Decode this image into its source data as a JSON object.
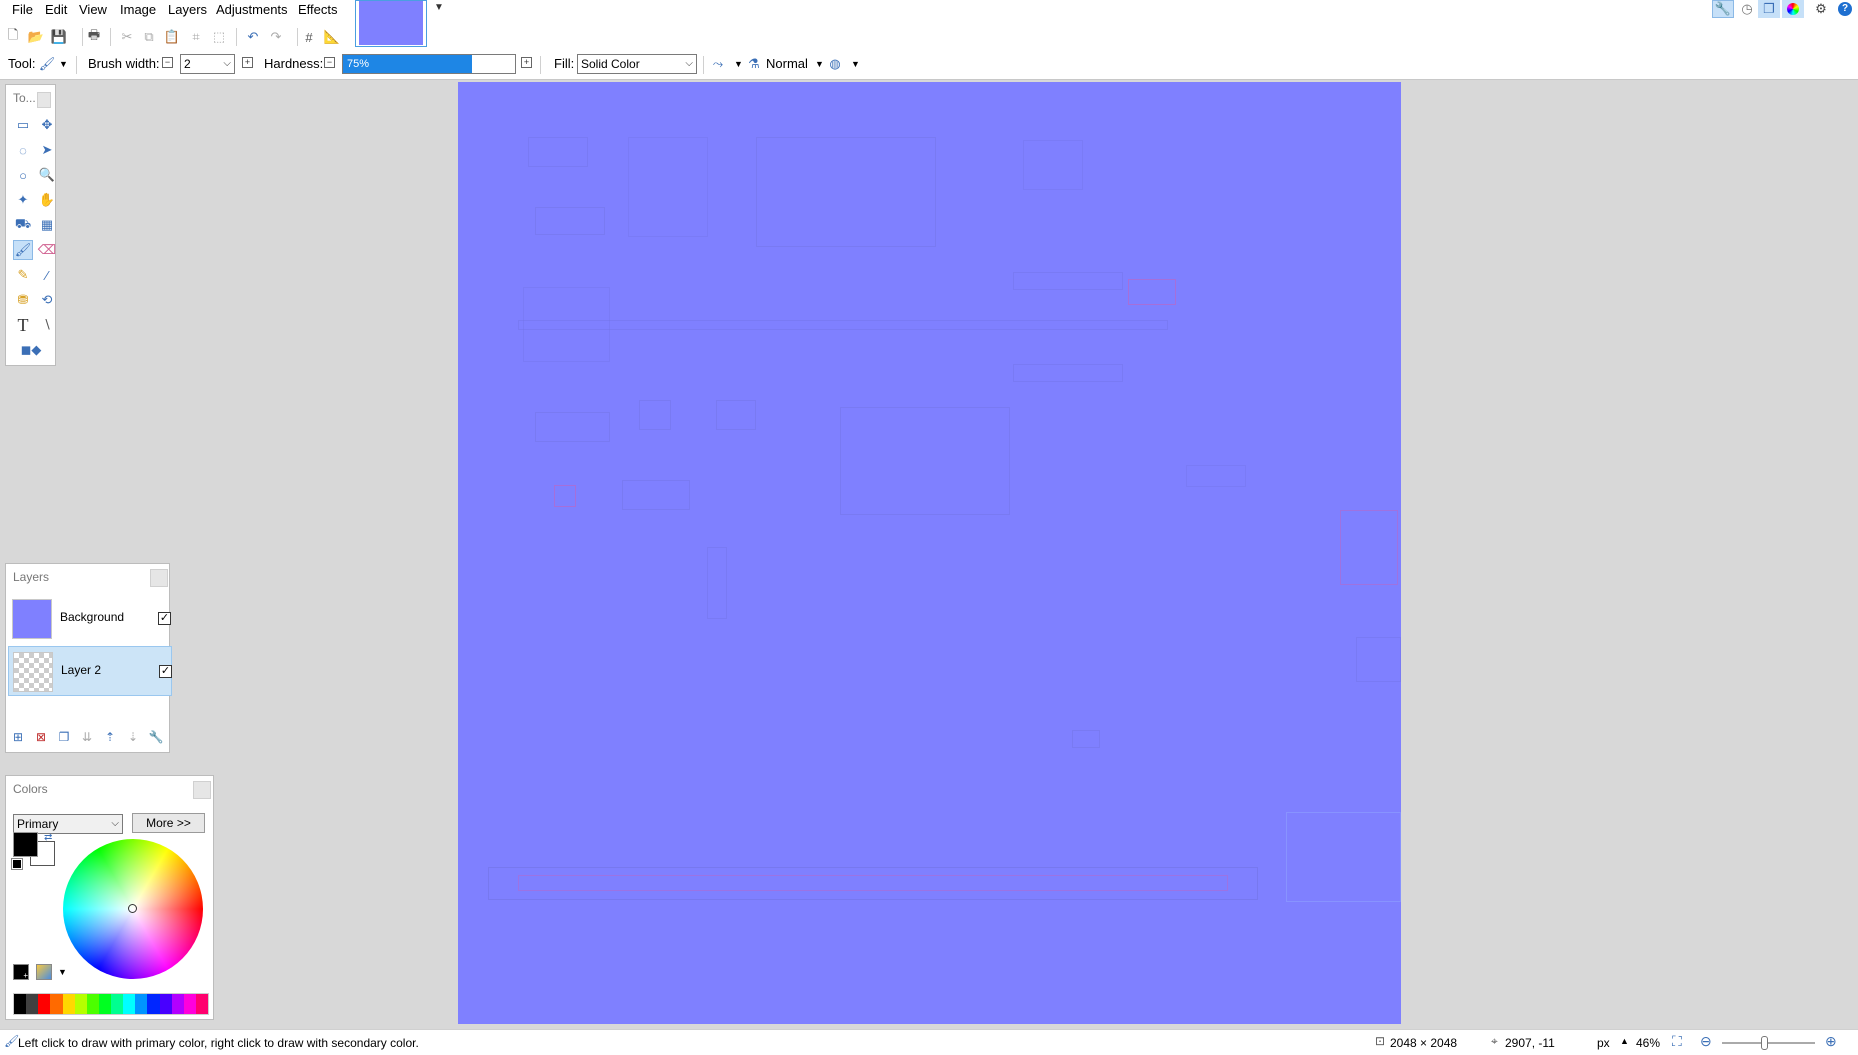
{
  "menu": {
    "items": [
      "File",
      "Edit",
      "View",
      "Image",
      "Layers",
      "Adjustments",
      "Effects"
    ]
  },
  "toolbar": {
    "tool_label": "Tool:",
    "brush_width_label": "Brush width:",
    "brush_width_value": "2",
    "hardness_label": "Hardness:",
    "hardness_value": "75%",
    "hardness_fraction": 0.75,
    "fill_label": "Fill:",
    "fill_value": "Solid Color",
    "blend_mode": "Normal"
  },
  "tools_panel": {
    "title": "To..."
  },
  "layers_panel": {
    "title": "Layers",
    "layers": [
      {
        "name": "Background",
        "visible": true,
        "selected": false
      },
      {
        "name": "Layer 2",
        "visible": true,
        "selected": true
      }
    ]
  },
  "colors_panel": {
    "title": "Colors",
    "mode": "Primary",
    "more_label": "More >>",
    "primary_color": "#000000",
    "secondary_color": "#ffffff",
    "palette": [
      "#000000",
      "#404040",
      "#ff0000",
      "#ff6a00",
      "#ffd800",
      "#b6ff00",
      "#4cff00",
      "#00ff21",
      "#00ff90",
      "#00ffff",
      "#0094ff",
      "#0026ff",
      "#4800ff",
      "#b200ff",
      "#ff00dc",
      "#ff006e"
    ]
  },
  "canvas": {
    "fill_color": "#7f80ff"
  },
  "status": {
    "hint": "Left click to draw with primary color, right click to draw with secondary color.",
    "image_size": "2048 × 2048",
    "cursor_pos": "2907, -11",
    "units": "px",
    "zoom": "46%"
  }
}
